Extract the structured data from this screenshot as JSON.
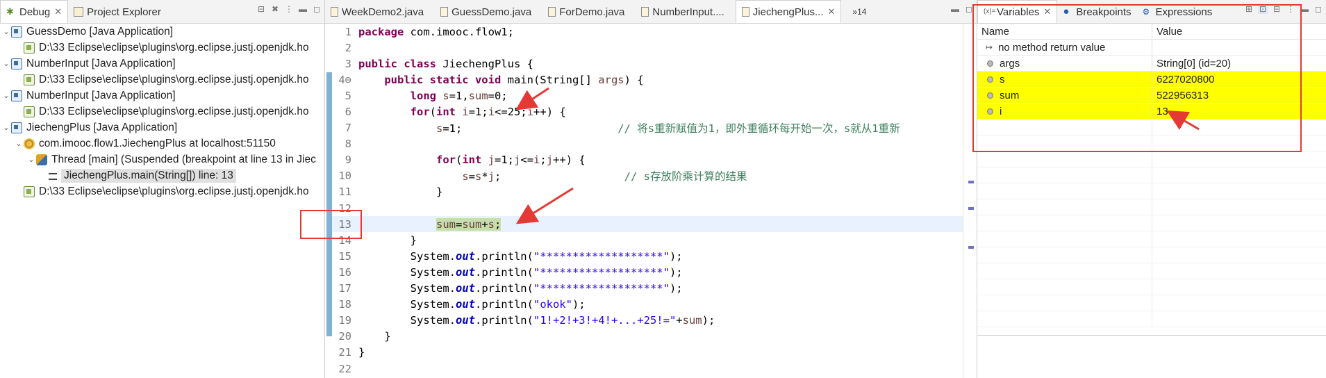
{
  "debug": {
    "tabs": [
      {
        "label": "Debug",
        "active": true
      },
      {
        "label": "Project Explorer",
        "active": false
      }
    ],
    "tree": [
      {
        "indent": 0,
        "twist": "v",
        "icon": "app",
        "label": "GuessDemo [Java Application]"
      },
      {
        "indent": 1,
        "twist": "",
        "icon": "proc",
        "label": "D:\\33 Eclipse\\eclipse\\plugins\\org.eclipse.justj.openjdk.ho"
      },
      {
        "indent": 0,
        "twist": "v",
        "icon": "app",
        "label": "NumberInput [Java Application]"
      },
      {
        "indent": 1,
        "twist": "",
        "icon": "proc",
        "label": "D:\\33 Eclipse\\eclipse\\plugins\\org.eclipse.justj.openjdk.ho"
      },
      {
        "indent": 0,
        "twist": "v",
        "icon": "app",
        "label": "NumberInput [Java Application]"
      },
      {
        "indent": 1,
        "twist": "",
        "icon": "proc",
        "label": "D:\\33 Eclipse\\eclipse\\plugins\\org.eclipse.justj.openjdk.ho"
      },
      {
        "indent": 0,
        "twist": "v",
        "icon": "app",
        "label": "JiechengPlus [Java Application]"
      },
      {
        "indent": 1,
        "twist": "v",
        "icon": "target",
        "label": "com.imooc.flow1.JiechengPlus at localhost:51150"
      },
      {
        "indent": 2,
        "twist": "v",
        "icon": "thread",
        "label": "Thread [main] (Suspended (breakpoint at line 13 in Jiec"
      },
      {
        "indent": 3,
        "twist": "",
        "icon": "frame",
        "label": "JiechengPlus.main(String[]) line: 13",
        "selected": true
      },
      {
        "indent": 1,
        "twist": "",
        "icon": "proc",
        "label": "D:\\33 Eclipse\\eclipse\\plugins\\org.eclipse.justj.openjdk.ho"
      }
    ]
  },
  "editor": {
    "tabs": [
      {
        "label": "WeekDemo2.java",
        "active": false
      },
      {
        "label": "GuessDemo.java",
        "active": false
      },
      {
        "label": "ForDemo.java",
        "active": false
      },
      {
        "label": "NumberInput....",
        "active": false
      },
      {
        "label": "JiechengPlus...",
        "active": true
      }
    ],
    "overflow": "»14",
    "current_line": 13,
    "lines": [
      {
        "n": "1",
        "html": "<span class='kw'>package</span> com.imooc.flow1;"
      },
      {
        "n": "2",
        "html": ""
      },
      {
        "n": "3",
        "html": "<span class='kw'>public class</span> JiechengPlus {"
      },
      {
        "n": "4⊖",
        "html": "    <span class='kw'>public static void</span> main(String[] <span class='var'>args</span>) {"
      },
      {
        "n": "5",
        "html": "        <span class='kw'>long</span> <span class='var'>s</span>=1,<span class='var'>sum</span>=0;"
      },
      {
        "n": "6",
        "html": "        <span class='kw'>for</span>(<span class='kw'>int</span> <span class='var'>i</span>=1;<span class='var'>i</span>&lt;=25;<span class='var'>i</span>++) {"
      },
      {
        "n": "7",
        "html": "            <span class='var'>s</span>=1;                        <span class='cmt'>// 将s重新赋值为1，即外重循环每开始一次，s就从1重新</span>"
      },
      {
        "n": "8",
        "html": ""
      },
      {
        "n": "9",
        "html": "            <span class='kw'>for</span>(<span class='kw'>int</span> <span class='var'>j</span>=1;<span class='var'>j</span>&lt;=<span class='var'>i</span>;<span class='var'>j</span>++) {"
      },
      {
        "n": "10",
        "html": "                <span class='var'>s</span>=<span class='var'>s</span>*<span class='var'>j</span>;                   <span class='cmt'>// s存放阶乘计算的结果</span>"
      },
      {
        "n": "11",
        "html": "            }"
      },
      {
        "n": "12",
        "html": ""
      },
      {
        "n": "13",
        "html": "            <span class='hl'><span class='var'>sum</span>=<span class='var'>sum</span>+<span class='var'>s</span>;</span>"
      },
      {
        "n": "14",
        "html": "        }"
      },
      {
        "n": "15",
        "html": "        System.<span class='fld'>out</span>.println(<span class='str'>\"*******************\"</span>);"
      },
      {
        "n": "16",
        "html": "        System.<span class='fld'>out</span>.println(<span class='str'>\"*******************\"</span>);"
      },
      {
        "n": "17",
        "html": "        System.<span class='fld'>out</span>.println(<span class='str'>\"*******************\"</span>);"
      },
      {
        "n": "18",
        "html": "        System.<span class='fld'>out</span>.println(<span class='str'>\"okok\"</span>);"
      },
      {
        "n": "19",
        "html": "        System.<span class='fld'>out</span>.println(<span class='str'>\"1!+2!+3!+4!+...+25!=\"</span>+<span class='var'>sum</span>);"
      },
      {
        "n": "20",
        "html": "    }"
      },
      {
        "n": "21",
        "html": "}"
      },
      {
        "n": "22",
        "html": ""
      }
    ]
  },
  "variables": {
    "tabs": [
      {
        "label": "Variables",
        "active": true
      },
      {
        "label": "Breakpoints",
        "active": false
      },
      {
        "label": "Expressions",
        "active": false
      }
    ],
    "columns": {
      "name": "Name",
      "value": "Value"
    },
    "rows": [
      {
        "name": "no method return value",
        "value": "",
        "changed": false,
        "kind": "return"
      },
      {
        "name": "args",
        "value": "String[0]  (id=20)",
        "changed": false,
        "kind": "var"
      },
      {
        "name": "s",
        "value": "6227020800",
        "changed": true,
        "kind": "var"
      },
      {
        "name": "sum",
        "value": "522956313",
        "changed": true,
        "kind": "var"
      },
      {
        "name": "i",
        "value": "13",
        "changed": true,
        "kind": "var"
      }
    ]
  },
  "colors": {
    "highlight_changed": "#ffff00",
    "annotation_red": "#e53935",
    "current_line_bg": "#e8f2fe"
  }
}
